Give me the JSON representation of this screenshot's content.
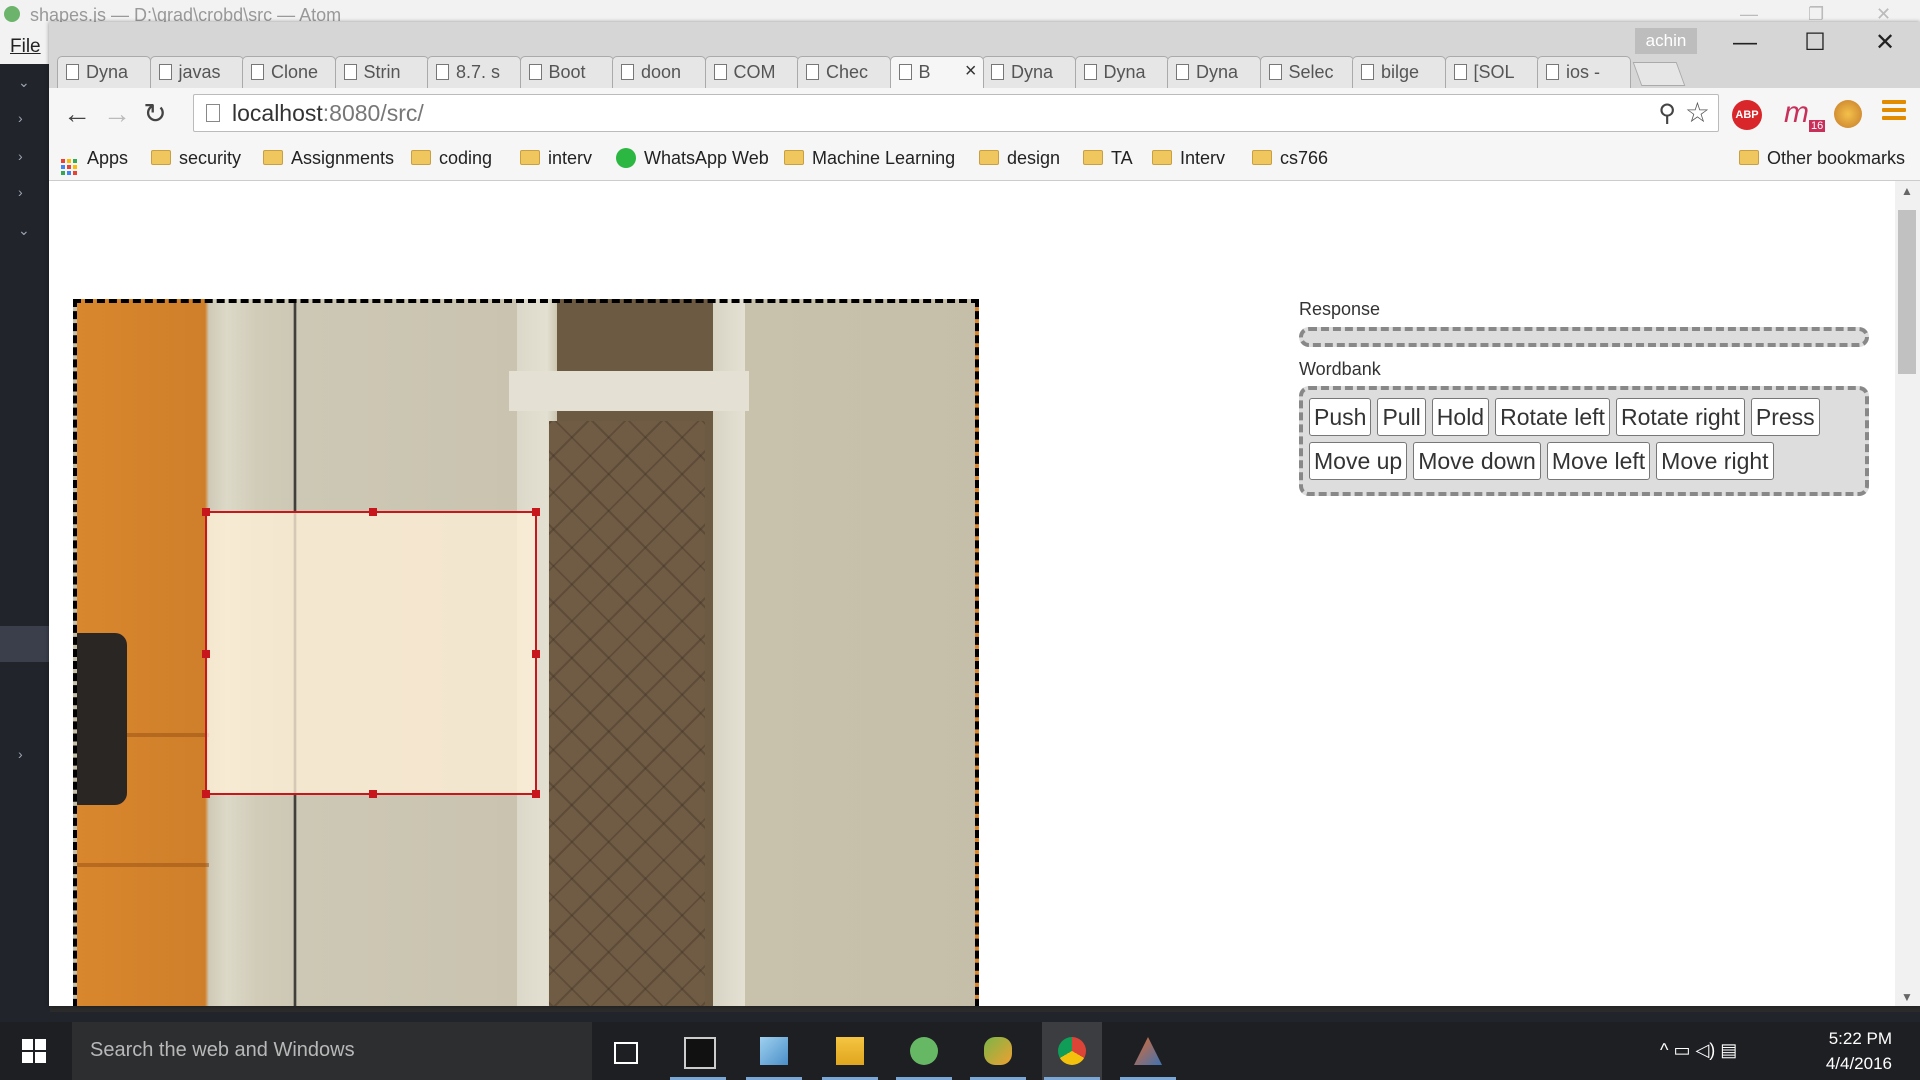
{
  "atom": {
    "title": "shapes.js — D:\\grad\\crobd\\src — Atom",
    "menu_file": "File",
    "tree_arrows": [
      "⌄",
      "›",
      "›",
      "›",
      "⌄",
      "›"
    ]
  },
  "browser": {
    "profile_name": "achin",
    "tabs": [
      {
        "label": "Dyna",
        "icon": "page-icon"
      },
      {
        "label": "javas",
        "icon": "stackoverflow-icon"
      },
      {
        "label": "Clone",
        "icon": "ext-icon"
      },
      {
        "label": "Strin",
        "icon": "ext-icon"
      },
      {
        "label": "8.7. s",
        "icon": "python-icon"
      },
      {
        "label": "Boot",
        "icon": "page-icon"
      },
      {
        "label": "doon",
        "icon": "github-icon"
      },
      {
        "label": "COM",
        "icon": "shield-icon"
      },
      {
        "label": "Chec",
        "icon": "page-icon"
      },
      {
        "label": "B",
        "icon": "page-icon",
        "active": true
      },
      {
        "label": "Dyna",
        "icon": "page-icon"
      },
      {
        "label": "Dyna",
        "icon": "page-icon"
      },
      {
        "label": "Dyna",
        "icon": "page-icon"
      },
      {
        "label": "Selec",
        "icon": "page-icon"
      },
      {
        "label": "bilge",
        "icon": "slack-icon"
      },
      {
        "label": "[SOL",
        "icon": "apple-icon"
      },
      {
        "label": "ios -",
        "icon": "stackoverflow-icon"
      }
    ],
    "active_tab_close": "×",
    "url_host": "localhost",
    "url_rest": ":8080/src/",
    "nav": {
      "back": "←",
      "forward": "→",
      "reload": "↻"
    },
    "window_controls": {
      "minimize": "—",
      "maximize": "☐",
      "close": "✕"
    },
    "extensions": {
      "abp": "ABP",
      "ext2": "m",
      "ext2_badge": "16"
    },
    "bookmarks": [
      {
        "label": "Apps",
        "type": "apps"
      },
      {
        "label": "security",
        "type": "folder"
      },
      {
        "label": "Assignments",
        "type": "folder"
      },
      {
        "label": "coding",
        "type": "folder"
      },
      {
        "label": "interv",
        "type": "folder"
      },
      {
        "label": "WhatsApp Web",
        "type": "whatsapp"
      },
      {
        "label": "Machine Learning",
        "type": "folder"
      },
      {
        "label": "design",
        "type": "folder"
      },
      {
        "label": "TA",
        "type": "folder"
      },
      {
        "label": "Interv",
        "type": "folder"
      },
      {
        "label": "cs766",
        "type": "folder"
      }
    ],
    "other_bookmarks": "Other bookmarks"
  },
  "page": {
    "response_label": "Response",
    "wordbank_label": "Wordbank",
    "words": [
      "Push",
      "Pull",
      "Hold",
      "Rotate left",
      "Rotate right",
      "Press",
      "Move up",
      "Move down",
      "Move left",
      "Move right"
    ]
  },
  "taskbar": {
    "search_placeholder": "Search the web and Windows",
    "apps": [
      "task-view-icon",
      "cmd-icon",
      "notepad-icon",
      "file-explorer-icon",
      "atom-icon",
      "eclipse-icon",
      "chrome-icon",
      "matlab-icon"
    ],
    "active_app": "chrome-icon",
    "tray": "^ ▭ ◁) ▤",
    "time": "5:22 PM",
    "date": "4/4/2016"
  },
  "colors": {
    "selection_border": "#c8161d",
    "abp_red": "#d8262a",
    "taskbar": "#1e1f22"
  }
}
